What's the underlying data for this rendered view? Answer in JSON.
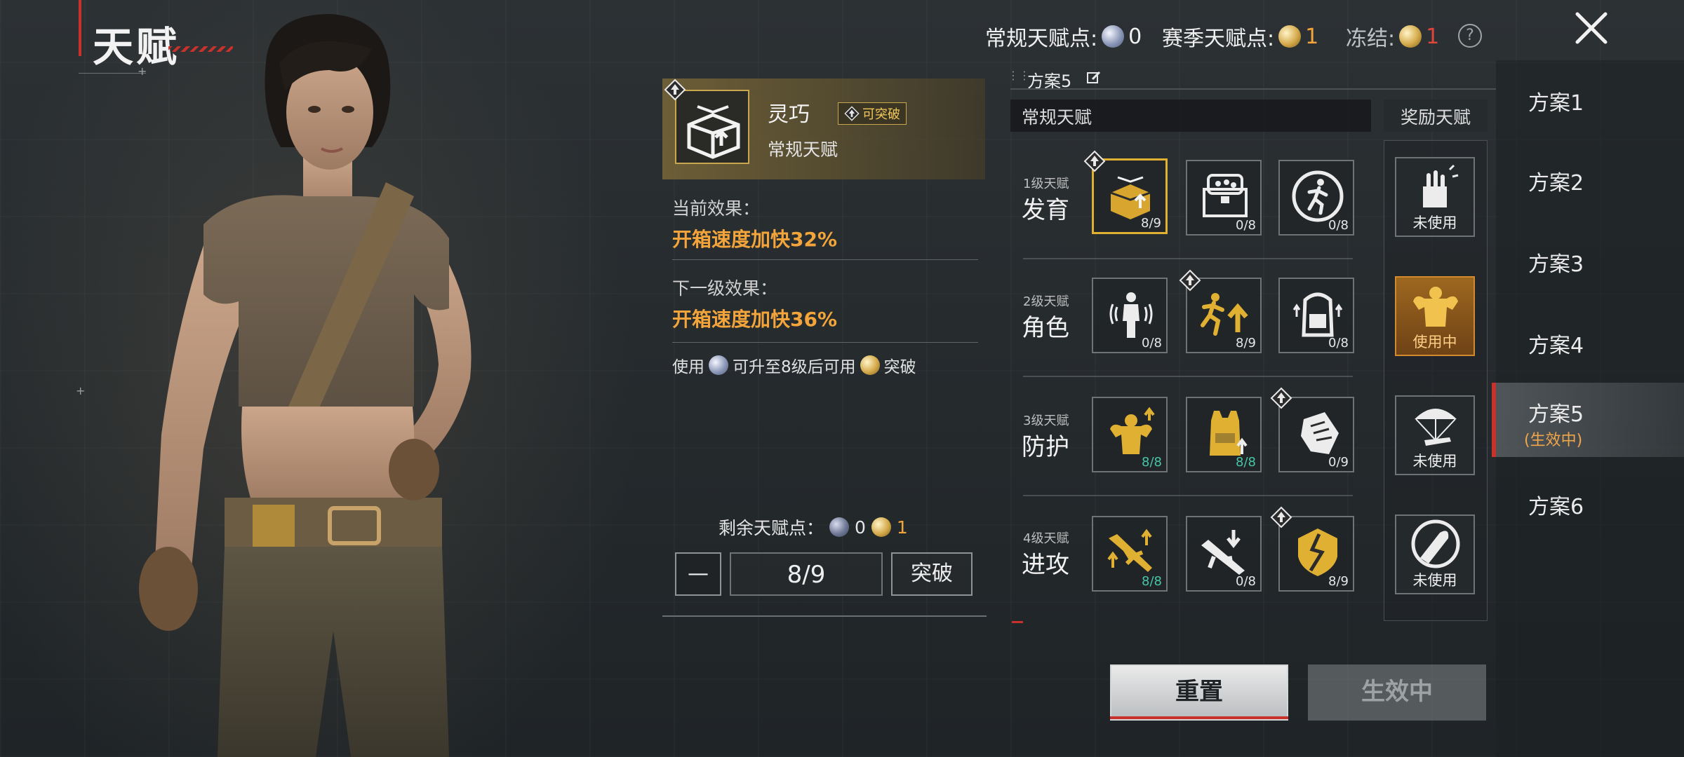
{
  "page": {
    "title": "天赋"
  },
  "points": {
    "regular_label": "常规天赋点:",
    "regular_value": "0",
    "season_label": "赛季天赋点:",
    "season_value": "1",
    "frozen_label": "冻结:",
    "frozen_value": "1"
  },
  "plans": {
    "items": [
      "方案1",
      "方案2",
      "方案3",
      "方案4",
      "方案5",
      "方案6"
    ],
    "active_index": 4,
    "active_status": "(生效中)"
  },
  "detail": {
    "name": "灵巧",
    "tag": "可突破",
    "type": "常规天赋",
    "current_label": "当前效果：",
    "current_effect": "开箱速度加快32%",
    "next_label": "下一级效果：",
    "next_effect": "开箱速度加快36%",
    "note_use": "使用",
    "note_middle": "可升至8级后可用",
    "note_break": "突破",
    "remain_label": "剩余天赋点：",
    "remain_regular": "0",
    "remain_season": "1",
    "minus": "—",
    "level": "8/9",
    "break_button": "突破"
  },
  "tree": {
    "plan_title": "方案5",
    "regular_header": "常规天赋",
    "bonus_header": "奖励天赋",
    "rows": [
      {
        "small": "1级天赋",
        "big": "发育",
        "slots": [
          {
            "icon": "crate-open-icon",
            "count": "8/9",
            "max": false,
            "selected": true,
            "breakable": true
          },
          {
            "icon": "supply-box-icon",
            "count": "0/8",
            "max": false,
            "selected": false,
            "breakable": false
          },
          {
            "icon": "running-man-icon",
            "count": "0/8",
            "max": false,
            "selected": false,
            "breakable": false
          }
        ]
      },
      {
        "small": "2级天赋",
        "big": "角色",
        "slots": [
          {
            "icon": "soldier-stealth-icon",
            "count": "0/8",
            "max": false,
            "selected": false,
            "breakable": false
          },
          {
            "icon": "sprint-boost-icon",
            "count": "8/9",
            "max": false,
            "selected": false,
            "breakable": true
          },
          {
            "icon": "backpack-upgrade-icon",
            "count": "0/8",
            "max": false,
            "selected": false,
            "breakable": false
          }
        ]
      },
      {
        "small": "3级天赋",
        "big": "防护",
        "slots": [
          {
            "icon": "muscle-boost-icon",
            "count": "8/8",
            "max": true,
            "selected": false,
            "breakable": false
          },
          {
            "icon": "vest-armor-icon",
            "count": "8/8",
            "max": true,
            "selected": false,
            "breakable": false
          },
          {
            "icon": "glove-icon",
            "count": "0/9",
            "max": false,
            "selected": false,
            "breakable": true
          }
        ]
      },
      {
        "small": "4级天赋",
        "big": "进攻",
        "slots": [
          {
            "icon": "rifle-boost-icon",
            "count": "8/8",
            "max": true,
            "selected": false,
            "breakable": false
          },
          {
            "icon": "rifle-drop-icon",
            "count": "0/8",
            "max": false,
            "selected": false,
            "breakable": false
          },
          {
            "icon": "broken-armor-icon",
            "count": "8/9",
            "max": false,
            "selected": false,
            "breakable": true
          }
        ]
      }
    ],
    "bonus": [
      {
        "icon": "hand-grab-icon",
        "label": "未使用",
        "active": false
      },
      {
        "icon": "muscle-man-icon",
        "label": "使用中",
        "active": true
      },
      {
        "icon": "parachute-icon",
        "label": "未使用",
        "active": false
      },
      {
        "icon": "bullet-icon",
        "label": "未使用",
        "active": false
      }
    ]
  },
  "buttons": {
    "reset": "重置",
    "active": "生效中"
  },
  "colors": {
    "accent_red": "#c8312c",
    "gold": "#e0b032",
    "orange_effect": "#f3a43a",
    "max_teal": "#47c6a6"
  }
}
